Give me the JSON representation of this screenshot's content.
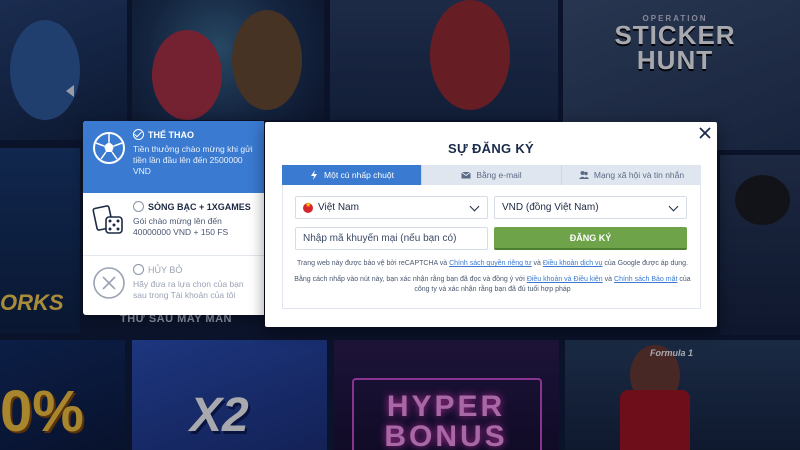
{
  "background": {
    "sticker_hunt_small": "OPERATION",
    "sticker_hunt_line1": "STICKER",
    "sticker_hunt_line2": "HUNT",
    "thu_sau_may_man": "THỨ SÁU MAY MẮN",
    "works": "ORKS",
    "percent": "0%",
    "x2": "X2",
    "hyper_line1": "HYPER",
    "hyper_line2": "BONUS",
    "formula": "Formula 1"
  },
  "bonus_panel": {
    "options": [
      {
        "title": "THỂ THAO",
        "desc": "Tiền thưởng chào mừng khi gửi tiền lần đầu lên đến 2500000 VND",
        "icon": "soccer-ball-icon",
        "selected": true
      },
      {
        "title": "SÒNG BẠC + 1XGAMES",
        "desc": "Gói chào mừng lên đến 40000000 VND + 150 FS",
        "icon": "casino-dice-cards-icon",
        "selected": false
      },
      {
        "title": "HỦY BỎ",
        "desc": "Hãy đưa ra lựa chọn của bạn sau trong Tài khoản của tôi",
        "icon": "cancel-x-icon",
        "selected": false
      }
    ]
  },
  "modal": {
    "title": "SỰ ĐĂNG KÝ",
    "tabs": [
      {
        "label": "Một cú nhấp chuột",
        "icon": "lightning-icon",
        "active": true
      },
      {
        "label": "Bằng e-mail",
        "icon": "envelope-icon",
        "active": false
      },
      {
        "label": "Mạng xã hội và tin nhắn",
        "icon": "users-icon",
        "active": false
      }
    ],
    "country": "Việt Nam",
    "currency": "VND (đồng Việt Nam)",
    "promo_placeholder": "Nhập mã khuyến mại (nếu bạn có)",
    "submit_label": "ĐĂNG KÝ",
    "legal1_text_a": "Trang web này được bảo vệ bởi reCAPTCHA và",
    "legal1_link1": "Chính sách quyền riêng tư",
    "legal1_text_b": "và",
    "legal1_link2": "Điều khoản dịch vụ",
    "legal1_text_c": "của Google được áp dụng.",
    "legal2_text_a": "Bằng cách nhấp vào nút này, bạn xác nhận rằng bạn đã đọc và đồng ý với",
    "legal2_link1": "Điều khoản và Điều kiện",
    "legal2_text_b": "và",
    "legal2_link2": "Chính sách Bảo mật",
    "legal2_text_c": "của công ty và xác nhận rằng bạn đã đủ tuổi hợp pháp",
    "colors": {
      "accent": "#3a7ad0",
      "submit": "#6ea34a"
    }
  }
}
